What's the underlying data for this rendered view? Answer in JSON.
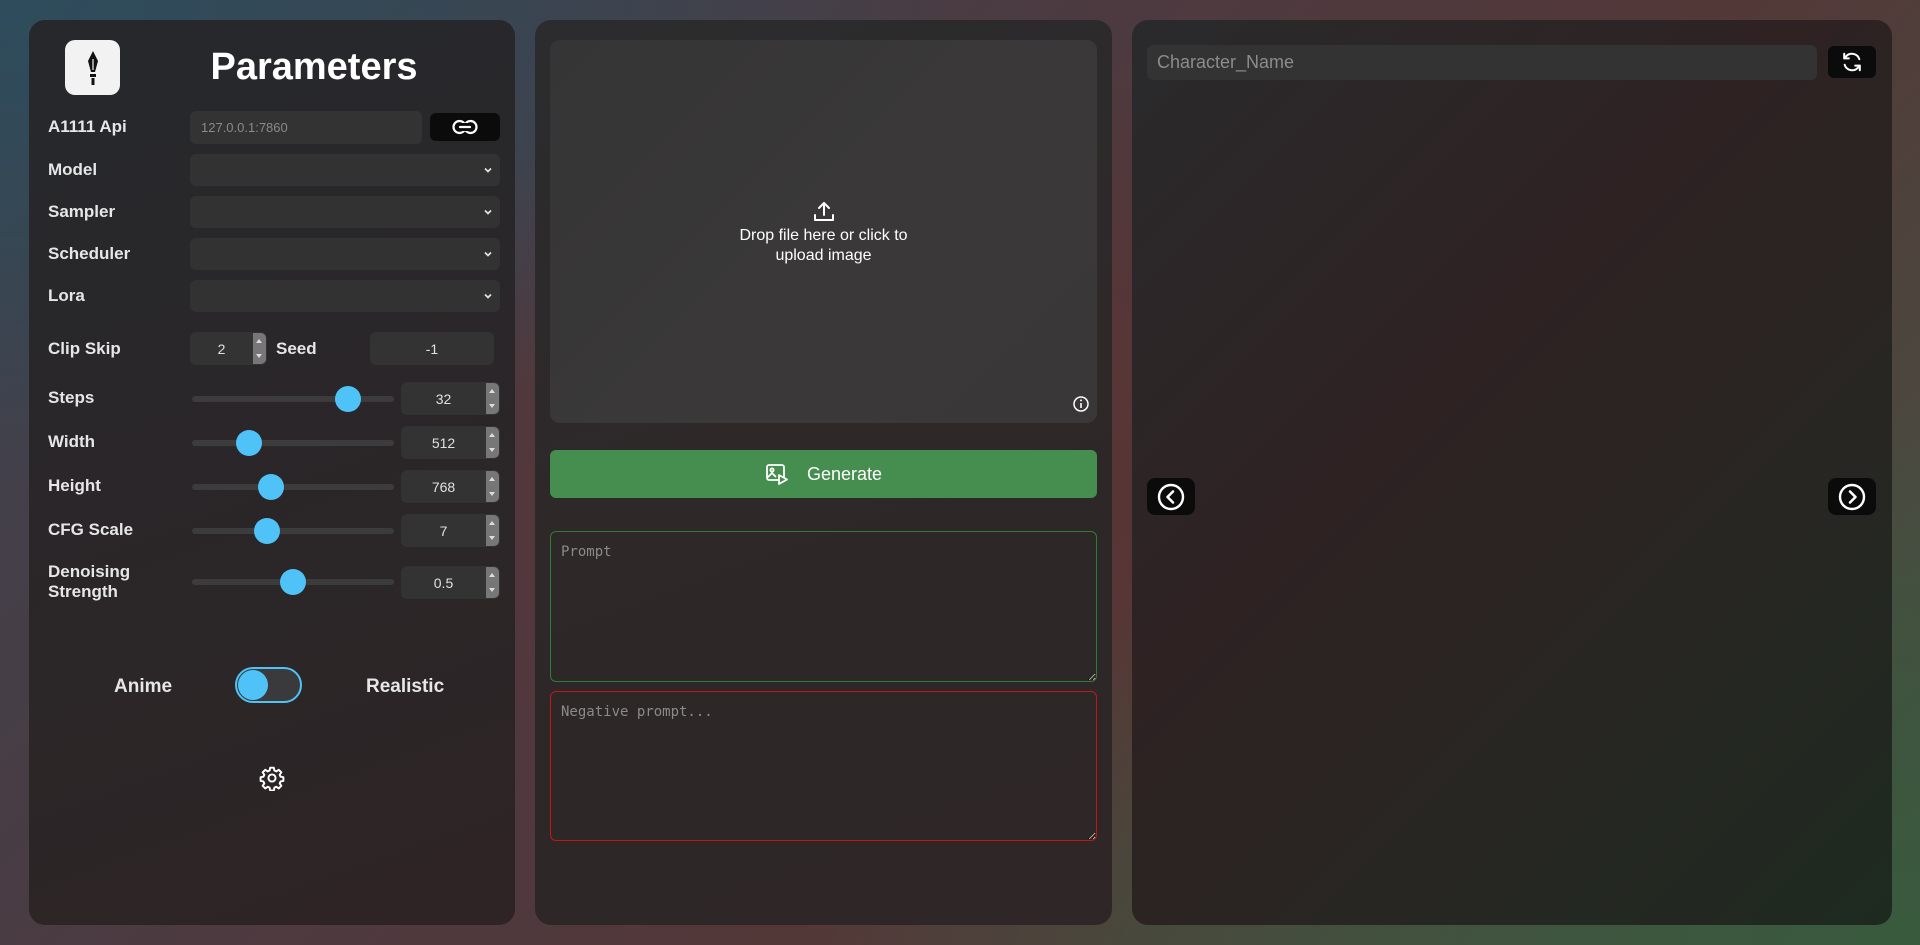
{
  "parameters": {
    "title": "Parameters",
    "api": {
      "label": "A1111 Api",
      "placeholder": "127.0.0.1:7860"
    },
    "selects": {
      "model_label": "Model",
      "sampler_label": "Sampler",
      "scheduler_label": "Scheduler",
      "lora_label": "Lora"
    },
    "clip_skip": {
      "label": "Clip Skip",
      "value": "2"
    },
    "seed": {
      "label": "Seed",
      "value": "-1"
    },
    "sliders": {
      "steps": {
        "label": "Steps",
        "value": "32",
        "fraction": 0.77
      },
      "width": {
        "label": "Width",
        "value": "512",
        "fraction": 0.28
      },
      "height": {
        "label": "Height",
        "value": "768",
        "fraction": 0.39
      },
      "cfg": {
        "label": "CFG Scale",
        "value": "7",
        "fraction": 0.37
      },
      "denoise": {
        "label_line1": "Denoising",
        "label_line2": "Strength",
        "value": "0.5",
        "fraction": 0.5
      }
    },
    "style_toggle": {
      "left_label": "Anime",
      "right_label": "Realistic",
      "state": "anime"
    },
    "settings_icon": "gear-icon"
  },
  "center": {
    "upload": {
      "line1": "Drop file here or click to",
      "line2": "upload image"
    },
    "generate_label": "Generate",
    "prompt_placeholder": "Prompt",
    "negative_placeholder": "Negative prompt..."
  },
  "viewer": {
    "character_placeholder": "Character_Name"
  },
  "colors": {
    "accent": "#4fc3f7",
    "generate": "#458e4f",
    "prompt_border": "#2f7d35",
    "negative_border": "#c01818"
  }
}
